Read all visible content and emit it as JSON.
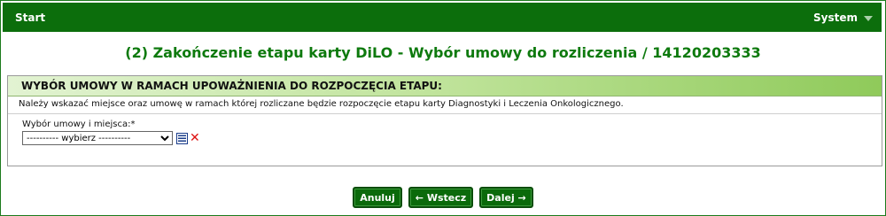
{
  "topbar": {
    "start": "Start",
    "system": "System"
  },
  "page": {
    "title": "(2) Zakończenie etapu karty DiLO - Wybór umowy do rozliczenia / 14120203333"
  },
  "section": {
    "header": "WYBÓR UMOWY W RAMACH UPOWAŻNIENIA DO ROZPOCZĘCIA ETAPU:",
    "description": "Należy wskazać miejsce oraz umowę w ramach której rozliczane będzie rozpoczęcie etapu karty Diagnostyki i Leczenia Onkologicznego.",
    "field_label": "Wybór umowy i miejsca:*",
    "select_value": "---------- wybierz ----------"
  },
  "buttons": {
    "cancel": "Anuluj",
    "back": "← Wstecz",
    "next": "Dalej →"
  },
  "colors": {
    "brand_green": "#0c6e0c",
    "title_green": "#0e7a0e",
    "delete_red": "#d11111"
  },
  "icons": {
    "list": "list-icon",
    "clear": "clear-icon",
    "menu": "chevron-down-icon"
  }
}
